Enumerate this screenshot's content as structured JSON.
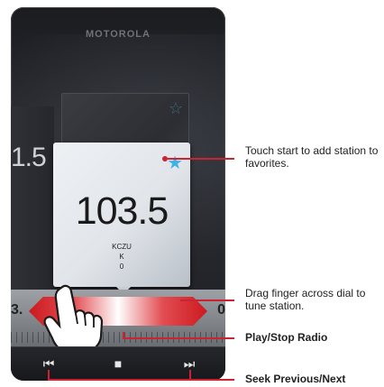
{
  "screen": {
    "brand_text": "MOTOROLA",
    "side_frequency": "1.5",
    "station": {
      "frequency": "103.5",
      "callsign": "KCZU",
      "line2": "K",
      "line3": "0"
    },
    "dial": {
      "left_number": "3.",
      "right_number": "0"
    }
  },
  "controls": {
    "prev_icon": "skip-previous-icon",
    "stop_icon": "stop-icon",
    "next_icon": "skip-next-icon"
  },
  "callouts": {
    "favorites": "Touch start to add station to favorites.",
    "dial": "Drag finger across dial to tune station.",
    "play_stop": "Play/Stop Radio",
    "seek": "Seek Previous/Next"
  },
  "colors": {
    "accent_red": "#cc2233",
    "favorite_star": "#3fb2e6"
  }
}
